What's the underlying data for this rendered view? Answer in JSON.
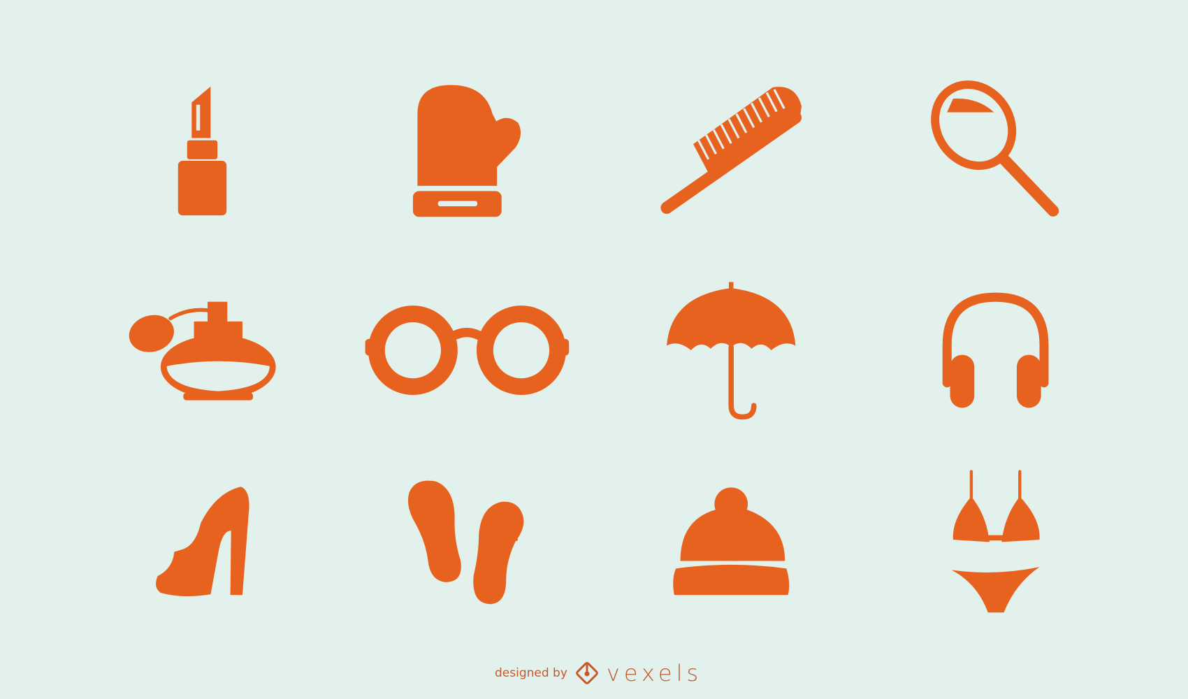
{
  "colors": {
    "icon": "#e8621f",
    "background": "#e3f1ec",
    "credit": "#c6582a"
  },
  "icons": [
    "lipstick-icon",
    "mitten-icon",
    "comb-icon",
    "hand-mirror-icon",
    "perfume-icon",
    "glasses-icon",
    "umbrella-icon",
    "headphones-icon",
    "high-heel-icon",
    "flip-flops-icon",
    "beanie-icon",
    "bikini-icon"
  ],
  "credit": {
    "prefix": "designed by",
    "brand": "vexels",
    "logo_text": "vexels"
  }
}
